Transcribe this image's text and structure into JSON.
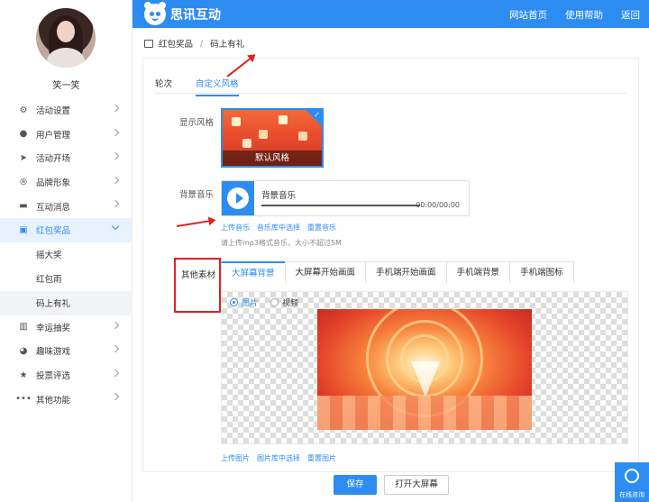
{
  "user": {
    "name": "笑一笑"
  },
  "header": {
    "brand": "思讯互动",
    "nav": [
      "网站首页",
      "使用帮助",
      "返回"
    ]
  },
  "sidebar": {
    "items": [
      {
        "label": "活动设置",
        "icon": "gear-icon",
        "glyph": "⚙"
      },
      {
        "label": "用户管理",
        "icon": "user-icon",
        "glyph": "●"
      },
      {
        "label": "活动开场",
        "icon": "send-icon",
        "glyph": "➤"
      },
      {
        "label": "品牌形象",
        "icon": "brand-icon",
        "glyph": "®"
      },
      {
        "label": "互动消息",
        "icon": "message-icon",
        "glyph": "▬"
      },
      {
        "label": "红包奖品",
        "icon": "gift-icon",
        "glyph": "▣",
        "active": true
      },
      {
        "label": "幸运抽奖",
        "icon": "lottery-icon",
        "glyph": "▥"
      },
      {
        "label": "趣味游戏",
        "icon": "game-icon",
        "glyph": "◕"
      },
      {
        "label": "投票评选",
        "icon": "star-icon",
        "glyph": "★"
      },
      {
        "label": "其他功能",
        "icon": "more-icon",
        "glyph": "•••"
      }
    ],
    "sub_items": [
      "摇大奖",
      "红包雨",
      "码上有礼"
    ]
  },
  "breadcrumb": [
    "红包奖品",
    "码上有礼"
  ],
  "top_tabs": [
    "轮次",
    "自定义风格"
  ],
  "labels": {
    "display_style": "显示风格",
    "bg_music": "背景音乐",
    "other_assets": "其他素材"
  },
  "style": {
    "caption": "默认风格"
  },
  "audio": {
    "title": "背景音乐",
    "time": "00:00/00:00"
  },
  "music_links": [
    "上传音乐",
    "音乐库中选择",
    "重置音乐"
  ],
  "music_hint": "请上传mp3格式音乐，大小不超过5M",
  "asset_tabs": [
    "大屏幕背景",
    "大屏幕开始画面",
    "手机端开始画面",
    "手机端背景",
    "手机端图标"
  ],
  "media_type": [
    "图片",
    "视频"
  ],
  "image_links": [
    "上传图片",
    "图片库中选择",
    "重置图片"
  ],
  "buttons": {
    "save": "保存",
    "open_screen": "打开大屏幕"
  },
  "consult": "在线咨询",
  "colors": {
    "accent": "#2d8cf0",
    "annotation": "#e02020"
  }
}
